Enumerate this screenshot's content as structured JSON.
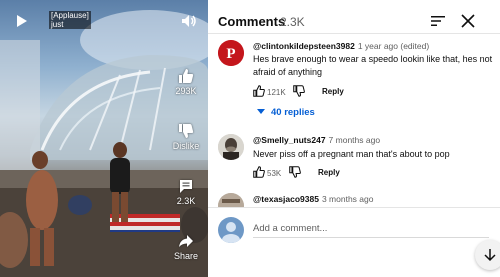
{
  "video": {
    "caption_line1": "[Applause]",
    "caption_line2": "just",
    "actions": [
      {
        "label": "293K",
        "icon": "thumbs-up-icon"
      },
      {
        "label": "Dislike",
        "icon": "thumbs-down-icon"
      },
      {
        "label": "2.3K",
        "icon": "comment-icon"
      },
      {
        "label": "Share",
        "icon": "share-icon"
      }
    ]
  },
  "comments_panel": {
    "title": "Comments",
    "count": "2.3K",
    "comments": [
      {
        "author": "@clintonkildepsteen3982",
        "meta": "1 year ago (edited)",
        "text": "Hes brave enough to wear a speedo lookin like that, hes not afraid of anything",
        "likes": "121K",
        "reply_label": "Reply",
        "replies_label": "40 replies",
        "avatar_letter": "P"
      },
      {
        "author": "@Smelly_nuts247",
        "meta": "7 months ago",
        "text": "Never piss off a pregnant man that's about to pop",
        "likes": "53K",
        "reply_label": "Reply"
      },
      {
        "author": "@texasjaco9385",
        "meta": "3 months ago"
      }
    ],
    "input_placeholder": "Add a comment..."
  },
  "colors": {
    "link_blue": "#065fd4",
    "text_primary": "#0f0f0f",
    "text_secondary": "#606060"
  }
}
